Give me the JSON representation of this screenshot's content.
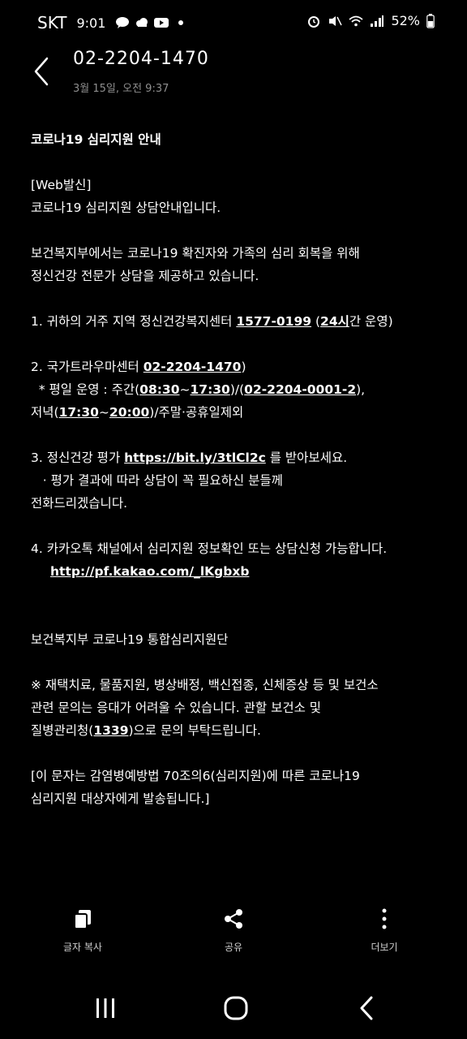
{
  "status_bar": {
    "carrier": "SKT",
    "time": "9:01",
    "battery": "52%"
  },
  "header": {
    "title": "02-2204-1470",
    "subtitle": "3월 15일, 오전 9:37"
  },
  "message": {
    "title": "코로나19 심리지원 안내",
    "lines": {
      "l1": "[Web발신]",
      "l2": "코로나19 심리지원 상담안내입니다.",
      "l3": "보건복지부에서는 코로나19 확진자와 가족의 심리 회복을 위해",
      "l4": "정신건강 전문가 상담을 제공하고 있습니다.",
      "l5a": "1. 귀하의 거주 지역 정신건강복지센터 ",
      "l5b": "1577-0199",
      "l5c": " (",
      "l5d": "24시",
      "l5e": "간 운영)",
      "l6a": "2. 국가트라우마센터 ",
      "l6b": "02-2204-1470",
      "l6c": ")",
      "l7a": "  * 평일 운영 : 주간(",
      "l7b": "08:30",
      "l7c": "~",
      "l7d": "17:30",
      "l7e": ")/(",
      "l7f": "02-2204-0001-2",
      "l7g": "),",
      "l8a": "저녁(",
      "l8b": "17:30",
      "l8c": "~",
      "l8d": "20:00",
      "l8e": ")/주말·공휴일제외",
      "l9a": "3. 정신건강 평가 ",
      "l9b": "https://bit.ly/3tlCl2c",
      "l9c": " 를 받아보세요.",
      "l10": "   · 평가 결과에 따라 상담이 꼭 필요하신 분들께",
      "l11": "전화드리겠습니다.",
      "l12": "4. 카카오톡 채널에서 심리지원 정보확인 또는 상담신청 가능합니다.",
      "l13": "http://pf.kakao.com/_lKgbxb",
      "l14": "보건복지부 코로나19 통합심리지원단",
      "l15": "※ 재택치료, 물품지원, 병상배정, 백신접종, 신체증상 등 및 보건소",
      "l16": "관련 문의는 응대가 어려울 수 있습니다. 관할 보건소 및",
      "l17a": "질병관리청(",
      "l17b": "1339",
      "l17c": ")으로 문의 부탁드립니다.",
      "l18": "[이 문자는 감염병예방법 70조의6(심리지원)에 따른 코로나19",
      "l19": "심리지원 대상자에게 발송됩니다.]"
    }
  },
  "actions": {
    "copy": "글자 복사",
    "share": "공유",
    "more": "더보기"
  }
}
